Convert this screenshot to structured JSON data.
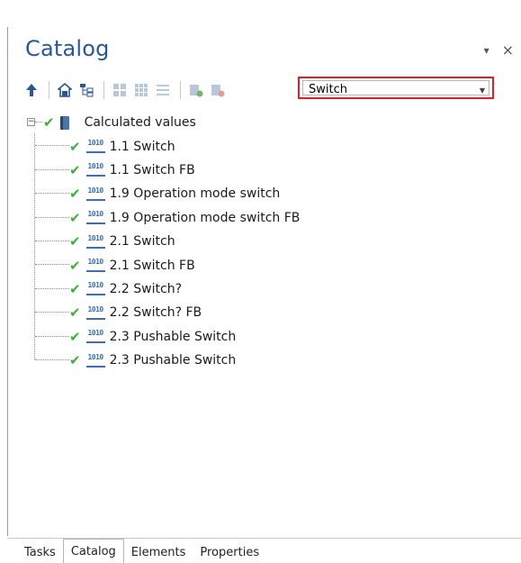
{
  "panel": {
    "title": "Catalog",
    "header_buttons": {
      "pin": "▾",
      "close": "×"
    }
  },
  "toolbar": {
    "icons": [
      "up-arrow-icon",
      "house-icon",
      "tree-structure-icon",
      "grid-large-icon",
      "grid-small-icon",
      "list-icon",
      "add-catalog-icon",
      "remove-catalog-icon"
    ]
  },
  "search": {
    "value": "Switch",
    "dropdown_arrow": "⌄"
  },
  "tree": {
    "root": {
      "label": "Calculated values",
      "expanded": true,
      "toggle": "−"
    },
    "items": [
      {
        "icon_text": "1010",
        "label": "1.1 Switch"
      },
      {
        "icon_text": "1010",
        "label": "1.1 Switch FB"
      },
      {
        "icon_text": "1010",
        "label": "1.9 Operation mode switch"
      },
      {
        "icon_text": "1010",
        "label": "1.9 Operation mode switch FB"
      },
      {
        "icon_text": "1010",
        "label": "2.1 Switch"
      },
      {
        "icon_text": "1010",
        "label": "2.1 Switch FB"
      },
      {
        "icon_text": "1010",
        "label": "2.2 Switch?"
      },
      {
        "icon_text": "1010",
        "label": "2.2 Switch? FB"
      },
      {
        "icon_text": "1010",
        "label": "2.3 Pushable Switch"
      },
      {
        "icon_text": "1010",
        "label": "2.3 Pushable Switch"
      }
    ]
  },
  "tabs": [
    {
      "label": "Tasks",
      "active": false
    },
    {
      "label": "Catalog",
      "active": true
    },
    {
      "label": "Elements",
      "active": false
    },
    {
      "label": "Properties",
      "active": false
    }
  ],
  "colors": {
    "accent": "#2b5797",
    "highlight": "#e41e26",
    "check": "#3daf3d",
    "icon_blue": "#3a6fb0"
  }
}
